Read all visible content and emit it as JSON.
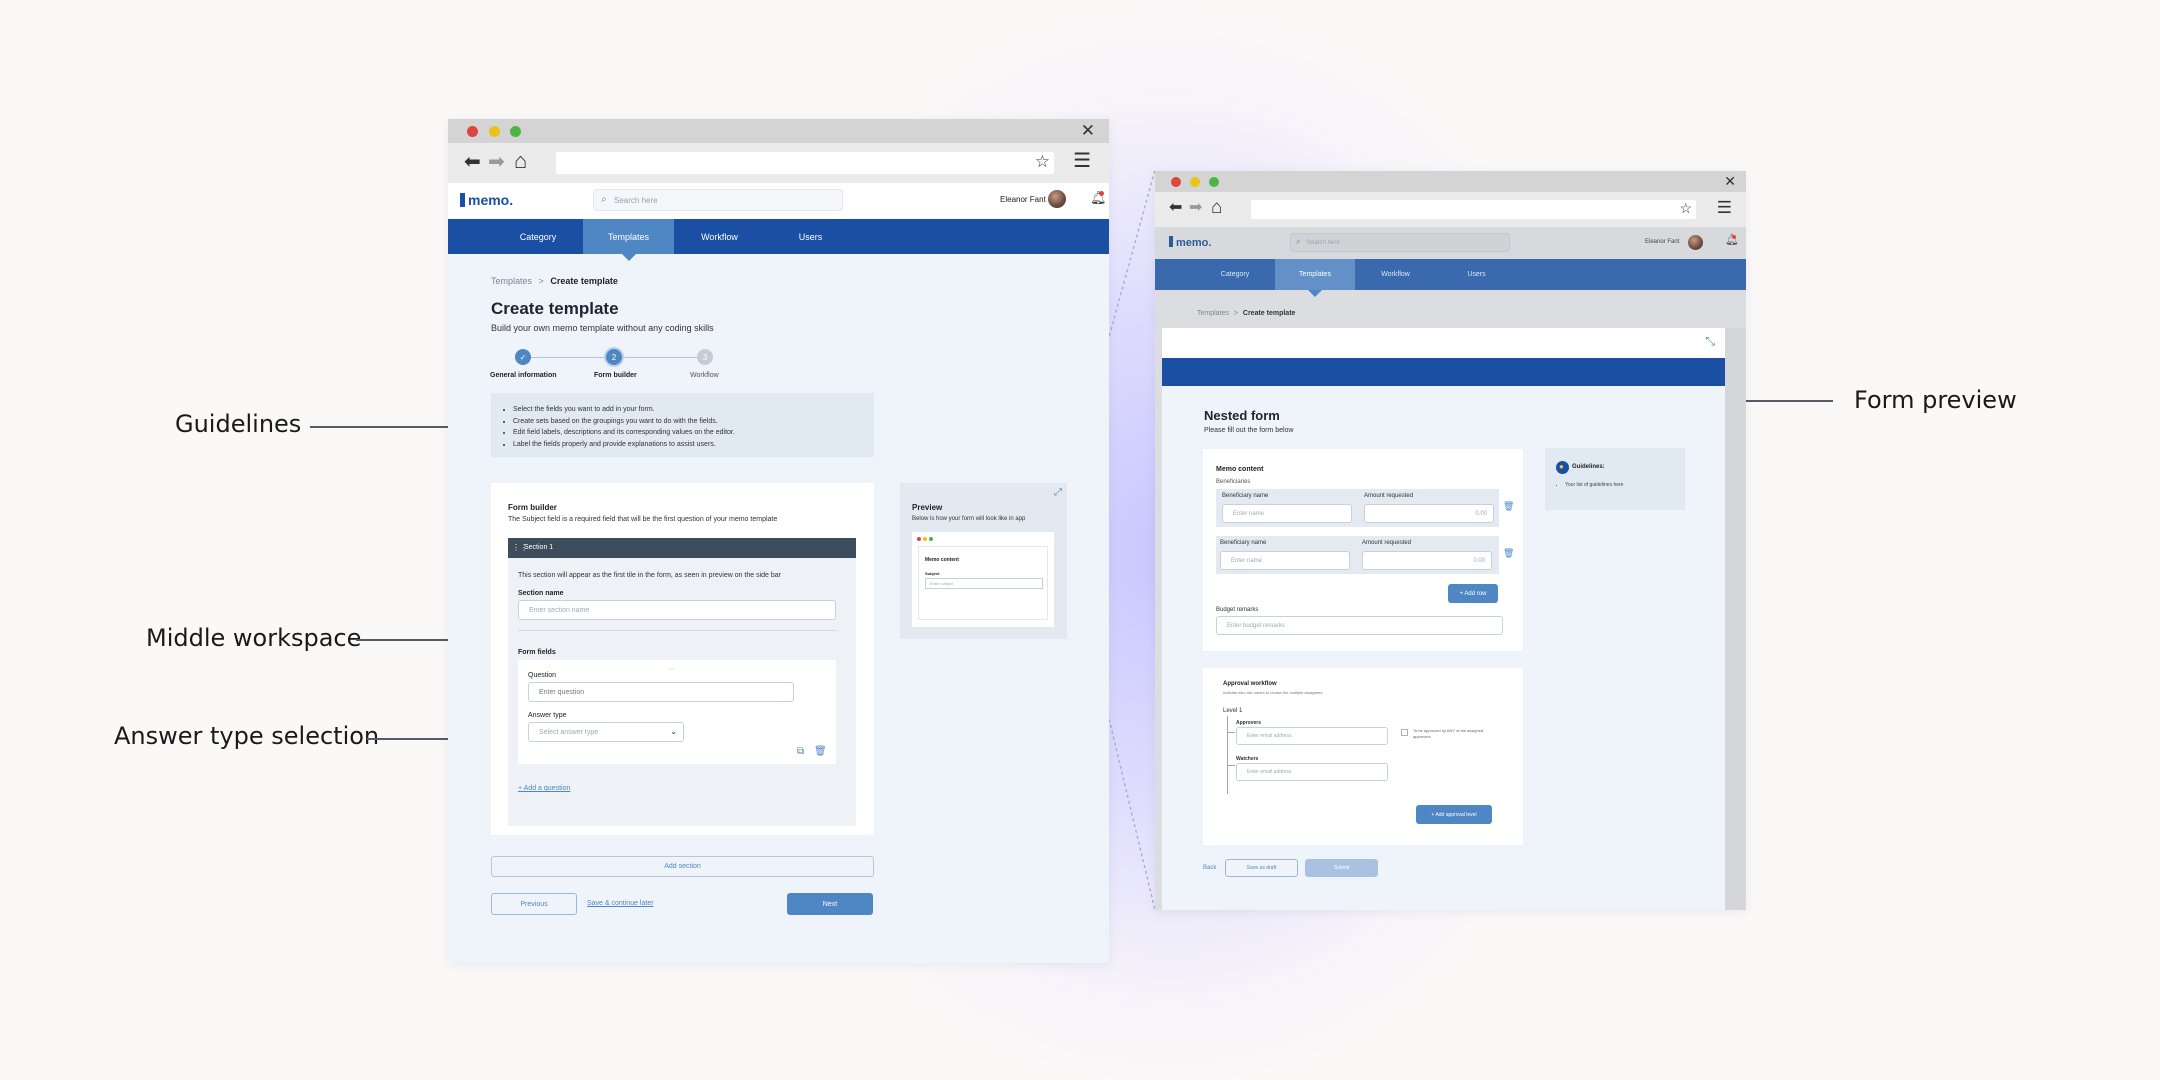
{
  "callouts": {
    "guidelines": "Guidelines",
    "middle_workspace": "Middle workspace",
    "answer_type": "Answer type selection",
    "form_preview": "Form preview"
  },
  "colors": {
    "primary": "#1a4fa3",
    "accent": "#4f86c4",
    "section_header": "#3d4d5c",
    "background": "#eff4fa"
  },
  "left": {
    "app": {
      "logo": "memo.",
      "search_placeholder": "Search here",
      "user_name": "Eleanor Fant"
    },
    "nav": [
      {
        "label": "Category"
      },
      {
        "label": "Templates",
        "active": true
      },
      {
        "label": "Workflow"
      },
      {
        "label": "Users"
      }
    ],
    "breadcrumb": {
      "parent": "Templates",
      "separator": ">",
      "current": "Create template"
    },
    "title": "Create template",
    "subtitle": "Build your own memo template without any coding skills",
    "steps": [
      {
        "number": "✓",
        "label": "General information",
        "state": "done"
      },
      {
        "number": "2",
        "label": "Form builder",
        "state": "current"
      },
      {
        "number": "3",
        "label": "Workflow",
        "state": "upcoming"
      }
    ],
    "guidelines": [
      "Select the fields you want to add in your form.",
      "Create sets based on the groupings you want to do with the fields.",
      "Edit field labels, descriptions and its corresponding values on the editor.",
      "Label the fields properly and provide explanations to assist users."
    ],
    "form_builder": {
      "title": "Form builder",
      "description": "The Subject field is a required field that will be the first question of your memo template",
      "section_title": "Section 1",
      "section_note": "This section will appear as the first tile in the form, as seen in preview on the side bar",
      "section_name_label": "Section name",
      "section_name_placeholder": "Enter section name",
      "form_fields_label": "Form fields",
      "question_label": "Question",
      "question_placeholder": "Enter question",
      "answer_type_label": "Answer type",
      "answer_type_placeholder": "Select answer type",
      "add_question": "+ Add a question"
    },
    "preview": {
      "title": "Preview",
      "description": "Below is how your form will look like in app",
      "mini_title": "Memo content",
      "mini_field_label": "Subject",
      "mini_field_placeholder": "Enter subject"
    },
    "add_section": "Add section",
    "previous": "Previous",
    "save_continue": "Save & continue later",
    "next": "Next"
  },
  "right": {
    "app": {
      "logo": "memo.",
      "search_placeholder": "Search here",
      "user_name": "Eleanor Fant"
    },
    "nav": [
      {
        "label": "Category"
      },
      {
        "label": "Templates",
        "active": true
      },
      {
        "label": "Workflow"
      },
      {
        "label": "Users"
      }
    ],
    "breadcrumb": {
      "parent": "Templates",
      "separator": ">",
      "current": "Create template"
    },
    "form": {
      "title": "Nested form",
      "subtitle": "Please fill out the form below",
      "memo_content": "Memo content",
      "beneficiaries": "Beneficiaries",
      "rows": [
        {
          "name_label": "Beneficiary name",
          "name_placeholder": "Enter name",
          "amount_label": "Amount requested",
          "amount_placeholder": "0.00"
        },
        {
          "name_label": "Beneficiary name",
          "name_placeholder": "Enter name",
          "amount_label": "Amount requested",
          "amount_placeholder": "0.00"
        }
      ],
      "add_row": "+ Add row",
      "budget_remarks_label": "Budget remarks",
      "budget_remarks_placeholder": "Enter budget remarks",
      "approval_title": "Approval workflow",
      "approval_desc": "Indicate who are meant to review the multiple assignees",
      "level": "Level 1",
      "approvers_label": "Approvers",
      "approvers_placeholder": "Enter email address",
      "checkbox_label": "To be approved by ANY of the assigned approvers",
      "watchers_label": "Watchers",
      "watchers_placeholder": "Enter email address",
      "add_approval_level": "+ Add approval level",
      "guidelines_title": "Guidelines:",
      "guidelines_item": "Your list of guidelines here",
      "back": "Back",
      "save_draft": "Save as draft",
      "submit": "Submit"
    }
  }
}
